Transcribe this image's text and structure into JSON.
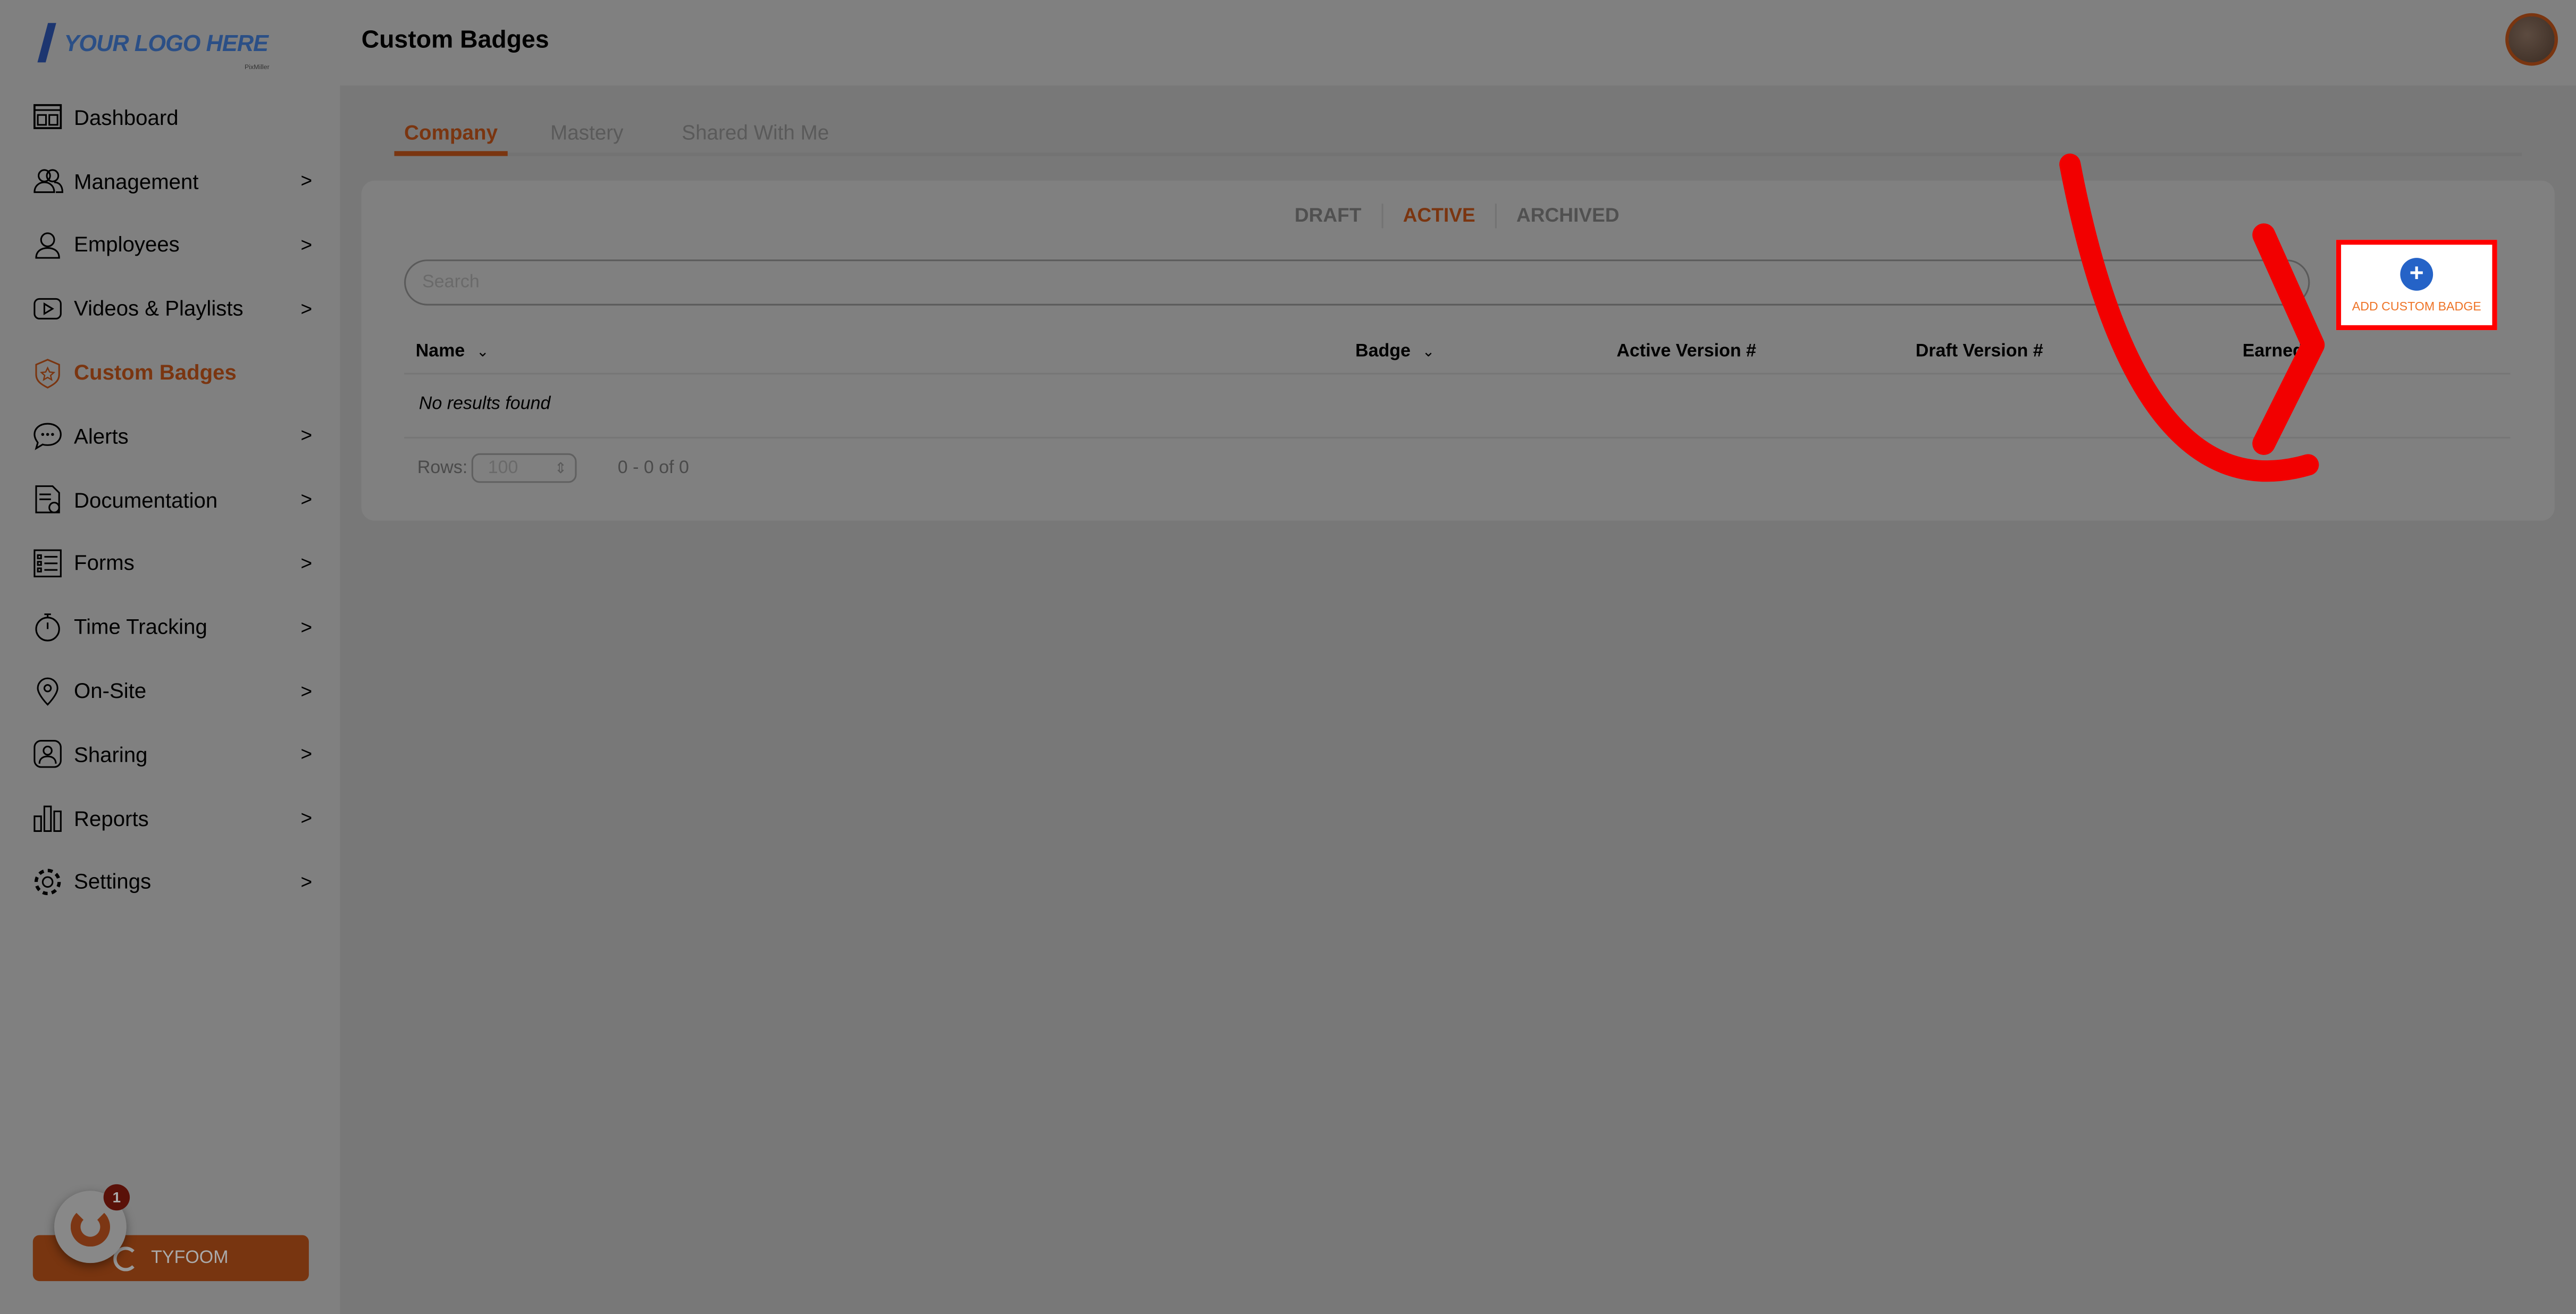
{
  "logo": {
    "text": "YOUR LOGO HERE",
    "subtext": "PixMiller"
  },
  "header": {
    "title": "Custom Badges"
  },
  "sidebar": {
    "items": [
      {
        "label": "Dashboard",
        "icon": "dashboard-icon",
        "chevron": false
      },
      {
        "label": "Management",
        "icon": "users-icon",
        "chevron": true
      },
      {
        "label": "Employees",
        "icon": "user-icon",
        "chevron": true
      },
      {
        "label": "Videos & Playlists",
        "icon": "play-icon",
        "chevron": true
      },
      {
        "label": "Custom Badges",
        "icon": "badge-icon",
        "chevron": false,
        "active": true
      },
      {
        "label": "Alerts",
        "icon": "chat-icon",
        "chevron": true
      },
      {
        "label": "Documentation",
        "icon": "document-icon",
        "chevron": true
      },
      {
        "label": "Forms",
        "icon": "form-list-icon",
        "chevron": true
      },
      {
        "label": "Time Tracking",
        "icon": "stopwatch-icon",
        "chevron": true
      },
      {
        "label": "On-Site",
        "icon": "location-pin-icon",
        "chevron": true
      },
      {
        "label": "Sharing",
        "icon": "share-user-icon",
        "chevron": true
      },
      {
        "label": "Reports",
        "icon": "bar-chart-icon",
        "chevron": true
      },
      {
        "label": "Settings",
        "icon": "gear-icon",
        "chevron": true
      }
    ],
    "chevron_glyph": ">",
    "tyfoom_button": "TYFOOM",
    "notification_count": "1"
  },
  "tabs": [
    "Company",
    "Mastery",
    "Shared With Me"
  ],
  "status_filters": [
    "DRAFT",
    "ACTIVE",
    "ARCHIVED"
  ],
  "search": {
    "placeholder": "Search"
  },
  "table": {
    "columns": [
      "Name",
      "Badge",
      "Active Version #",
      "Draft Version #",
      "Earned"
    ],
    "empty_text": "No results found"
  },
  "pagination": {
    "rows_label": "Rows:",
    "rows_value": "100",
    "range": "0 - 0 of 0"
  },
  "add_button": {
    "label": "ADD CUSTOM BADGE",
    "icon": "plus-icon"
  },
  "colors": {
    "accent": "#e8692a",
    "overlay_accent": "#7a3510",
    "add_icon": "#2563c7",
    "highlight": "#ff0000"
  }
}
